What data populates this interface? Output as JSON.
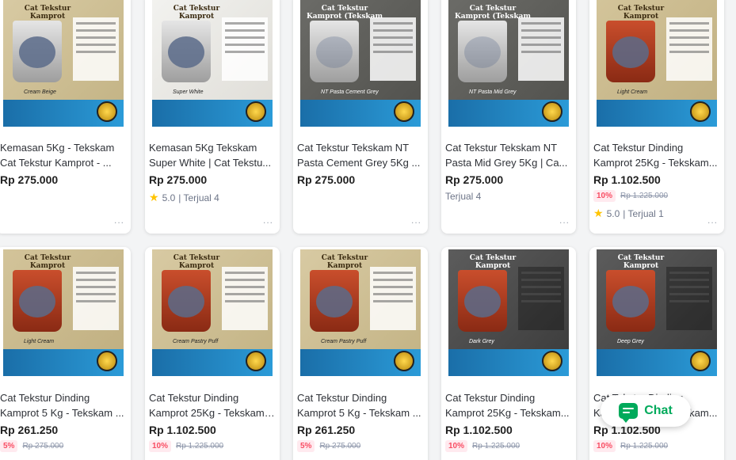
{
  "products": [
    {
      "title": "Kemasan 5Kg - Tekskam Cat Tekstur Kamprot - ...",
      "price": "Rp 275.000",
      "img_title": "Cat Tekstur Kamprot",
      "img_variant": "Cream Beige"
    },
    {
      "title": "Kemasan 5Kg Tekskam Super White | Cat Tekstu...",
      "price": "Rp 275.000",
      "rating": "5.0",
      "sold": "| Terjual 4",
      "img_title": "Cat Tekstur Kamprot",
      "img_variant": "Super White"
    },
    {
      "title": "Cat Tekstur Tekskam NT Pasta Cement Grey 5Kg ...",
      "price": "Rp 275.000",
      "img_title": "Cat Tekstur Kamprot (Tekskam Pasta)",
      "img_variant": "NT Pasta Cement Grey"
    },
    {
      "title": "Cat Tekstur Tekskam NT Pasta Mid Grey 5Kg | Ca...",
      "price": "Rp 275.000",
      "sold": "Terjual 4",
      "img_title": "Cat Tekstur Kamprot (Tekskam Pasta)",
      "img_variant": "NT Pasta Mid Grey"
    },
    {
      "title": "Cat Tekstur Dinding Kamprot 25Kg - Tekskam...",
      "price": "Rp 1.102.500",
      "discount": "10%",
      "original_price": "Rp 1.225.000",
      "rating": "5.0",
      "sold": "| Terjual 1",
      "img_title": "Cat Tekstur Kamprot",
      "img_variant": "Light Cream"
    },
    {
      "title": "Cat Tekstur Dinding Kamprot 5 Kg - Tekskam ...",
      "price": "Rp 261.250",
      "discount": "5%",
      "original_price": "Rp 275.000",
      "img_title": "Cat Tekstur Kamprot",
      "img_variant": "Light Cream"
    },
    {
      "title": "Cat Tekstur Dinding Kamprot 25Kg - Tekskam ...",
      "price": "Rp 1.102.500",
      "discount": "10%",
      "original_price": "Rp 1.225.000",
      "img_title": "Cat Tekstur Kamprot",
      "img_variant": "Cream Pastry Puff"
    },
    {
      "title": "Cat Tekstur Dinding Kamprot 5 Kg - Tekskam ...",
      "price": "Rp 261.250",
      "discount": "5%",
      "original_price": "Rp 275.000",
      "img_title": "Cat Tekstur Kamprot",
      "img_variant": "Cream Pastry Puff"
    },
    {
      "title": "Cat Tekstur Dinding Kamprot 25Kg - Tekskam...",
      "price": "Rp 1.102.500",
      "discount": "10%",
      "original_price": "Rp 1.225.000",
      "img_title": "Cat Tekstur Kamprot",
      "img_variant": "Dark Grey"
    },
    {
      "title": "Cat Tekstur Dinding Kamprot 25Kg - Tekskam...",
      "price": "Rp 1.102.500",
      "discount": "10%",
      "original_price": "Rp 1.225.000",
      "img_title": "Cat Tekstur Kamprot",
      "img_variant": "Deep Grey"
    }
  ],
  "more_icon": "...",
  "chat": {
    "label": "Chat",
    "icon": "chat-bubble-icon",
    "color": "#00aa5b"
  },
  "colors": {
    "discount_bg": "#ffeaef",
    "discount_text": "#f94d63",
    "star": "#ffc400"
  }
}
